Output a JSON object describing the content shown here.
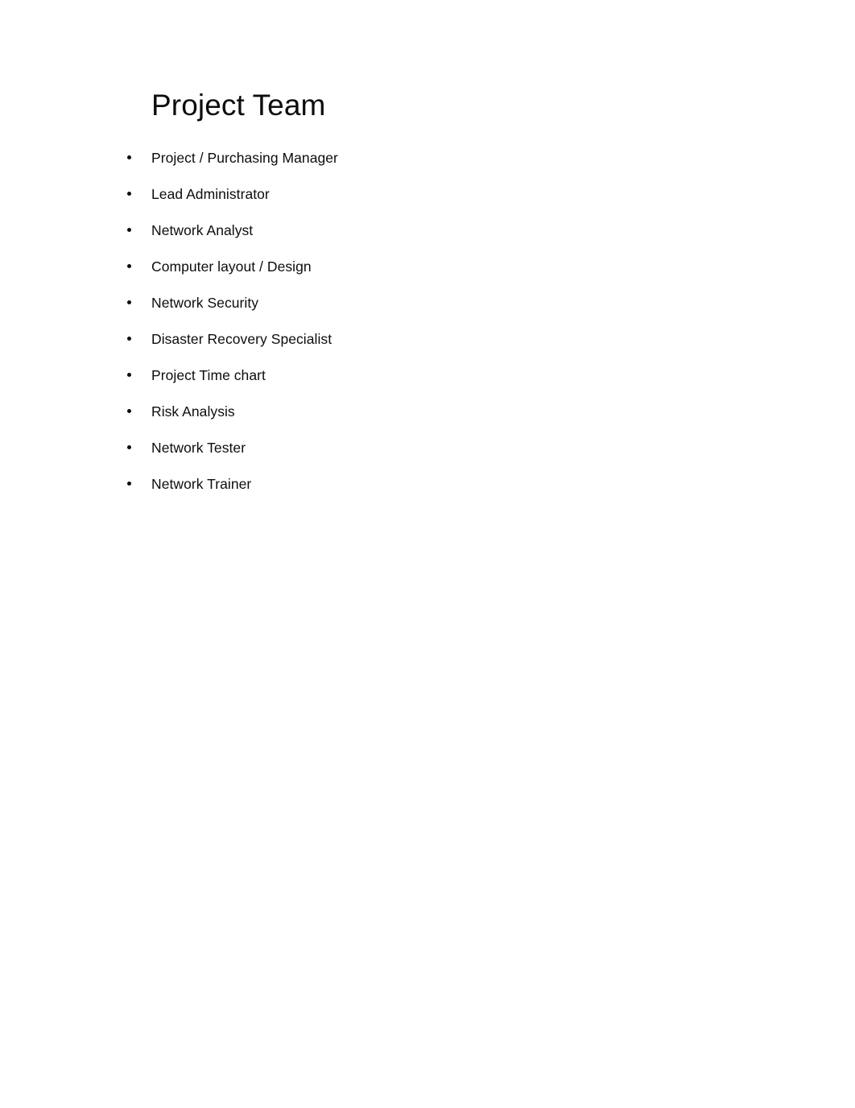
{
  "document": {
    "title": "Project Team",
    "background_color": "#ffffff",
    "text_color": "#0d0d0d",
    "bullet_glyph": "bullet-dot"
  },
  "team": {
    "items": [
      {
        "label": "Project / Purchasing Manager"
      },
      {
        "label": "Lead Administrator"
      },
      {
        "label": "Network Analyst"
      },
      {
        "label": "Computer layout / Design"
      },
      {
        "label": "Network Security"
      },
      {
        "label": "Disaster Recovery Specialist"
      },
      {
        "label": "Project Time chart"
      },
      {
        "label": "Risk Analysis"
      },
      {
        "label": "Network Tester"
      },
      {
        "label": "Network Trainer"
      }
    ]
  }
}
